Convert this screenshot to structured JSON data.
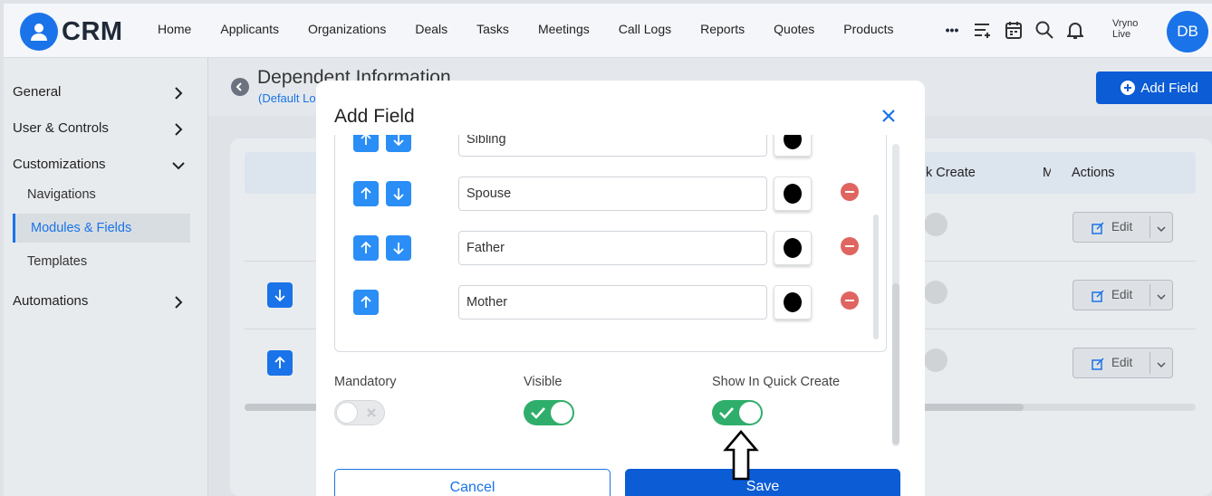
{
  "app": {
    "logo_text": "CRM"
  },
  "nav": {
    "items": [
      "Home",
      "Applicants",
      "Organizations",
      "Deals",
      "Tasks",
      "Meetings",
      "Call Logs",
      "Reports",
      "Quotes",
      "Products"
    ],
    "more": "•••",
    "icons": [
      "add-list-icon",
      "calendar-icon",
      "search-icon",
      "bell-icon"
    ]
  },
  "user": {
    "name_line1": "Vryno",
    "name_line2": "Live",
    "initials": "DB"
  },
  "sidebar": {
    "general": "General",
    "user_controls": "User & Controls",
    "customizations": "Customizations",
    "navigations": "Navigations",
    "modules_fields": "Modules & Fields",
    "templates": "Templates",
    "automations": "Automations"
  },
  "page": {
    "title": "Dependent Information",
    "subtitle": "(Default Lo",
    "add_field_label": "Add Field"
  },
  "table": {
    "col_quick_create": "k Create",
    "col_m": "M",
    "col_actions": "Actions",
    "edit_label": "Edit"
  },
  "modal": {
    "title": "Add Field",
    "items": [
      {
        "value": "Sibling"
      },
      {
        "value": "Spouse"
      },
      {
        "value": "Father"
      },
      {
        "value": "Mother"
      }
    ],
    "mandatory_label": "Mandatory",
    "visible_label": "Visible",
    "quick_create_label": "Show In Quick Create",
    "cancel_label": "Cancel",
    "save_label": "Save"
  },
  "colors": {
    "accent": "#1a73e8",
    "toggle_on": "#2fae6b",
    "remove": "#e0645f"
  }
}
